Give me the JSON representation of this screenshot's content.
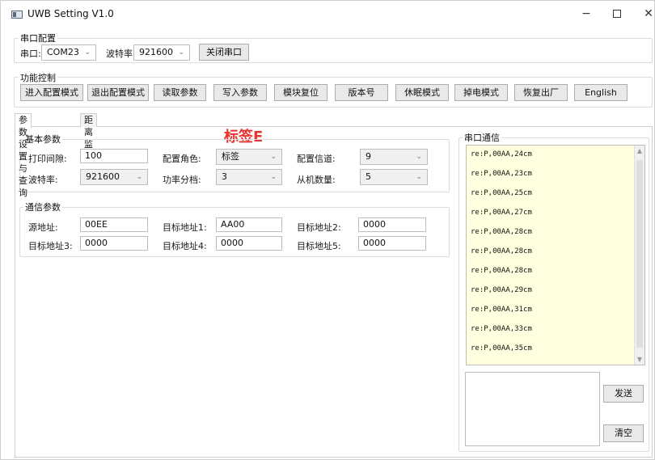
{
  "window": {
    "title": "UWB Setting V1.0",
    "controls": {
      "minimize": "−",
      "close": "✕"
    }
  },
  "serial_config": {
    "group_title": "串口配置",
    "port_label": "串口:",
    "port_value": "COM23",
    "baud_label": "波特率:",
    "baud_value": "921600",
    "close_port_button": "关闭串口"
  },
  "function_control": {
    "group_title": "功能控制",
    "buttons": [
      "进入配置模式",
      "退出配置模式",
      "读取参数",
      "写入参数",
      "模块复位",
      "版本号",
      "休眠模式",
      "掉电模式",
      "恢复出厂",
      "English"
    ]
  },
  "tabs": [
    "参数设置与查询",
    "距离监控"
  ],
  "overlay_label": "标签E",
  "basic_params": {
    "group_title": "基本参数",
    "print_interval_label": "打印间隙:",
    "print_interval_value": "100",
    "role_label": "配置角色:",
    "role_value": "标签",
    "channel_label": "配置信道:",
    "channel_value": "9",
    "baud_label": "波特率:",
    "baud_value": "921600",
    "power_label": "功率分档:",
    "power_value": "3",
    "slave_count_label": "从机数量:",
    "slave_count_value": "5"
  },
  "comm_params": {
    "group_title": "通信参数",
    "src_addr_label": "源地址:",
    "src_addr_value": "00EE",
    "target1_label": "目标地址1:",
    "target1_value": "AA00",
    "target2_label": "目标地址2:",
    "target2_value": "0000",
    "target3_label": "目标地址3:",
    "target3_value": "0000",
    "target4_label": "目标地址4:",
    "target4_value": "0000",
    "target5_label": "目标地址5:",
    "target5_value": "0000"
  },
  "serial_comm": {
    "title": "串口通信",
    "lines": [
      "re:P,00AA,24cm",
      "re:P,00AA,23cm",
      "re:P,00AA,25cm",
      "re:P,00AA,27cm",
      "re:P,00AA,28cm",
      "re:P,00AA,28cm",
      "re:P,00AA,28cm",
      "re:P,00AA,29cm",
      "re:P,00AA,31cm",
      "re:P,00AA,33cm",
      "re:P,00AA,35cm"
    ],
    "send_button": "发送",
    "clear_button": "清空"
  },
  "icons": {
    "app": "app-window-icon",
    "dropdown": "chevron-down-icon",
    "scroll_up": "chevron-up-icon",
    "scroll_down": "chevron-down-icon"
  },
  "colors": {
    "overlay": "#e8332e",
    "serial_bg": "#ffffe0",
    "button_bg": "#e9e9e9"
  }
}
